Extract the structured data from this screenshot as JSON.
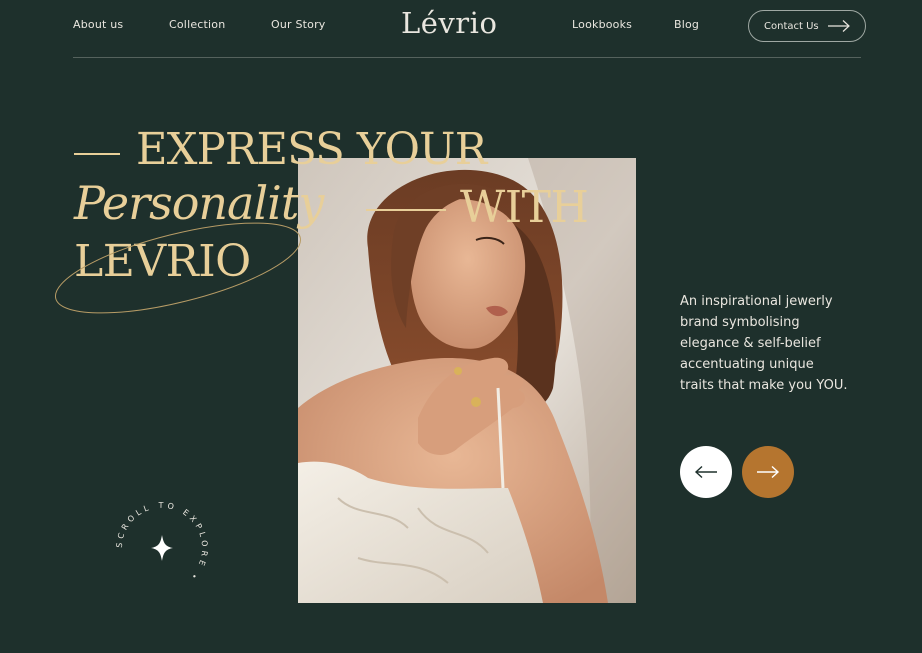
{
  "nav": {
    "left_links": [
      "About us",
      "Collection",
      "Our Story"
    ],
    "logo": "Lévrio",
    "right_links": [
      "Lookbooks",
      "Blog"
    ],
    "contact_label": "Contact Us"
  },
  "hero": {
    "line1": "EXPRESS YOUR",
    "line2_italic": "Personality",
    "line2_rest": "WITH",
    "line3": "LEVRIO",
    "tagline_lines": [
      "An inspirational jewerly",
      "brand symbolising",
      "elegance & self-belief",
      "accentuating unique",
      "traits that make you YOU."
    ]
  },
  "scroll_badge": {
    "text": "SCROLL TO EXPLORE •"
  },
  "colors": {
    "background": "#1e302c",
    "gold": "#e8cf99",
    "accent_brown": "#b5752f"
  },
  "icons": {
    "contact": "arrow-right-icon",
    "prev": "arrow-left-icon",
    "next": "arrow-right-icon",
    "badge": "sparkle-icon"
  }
}
